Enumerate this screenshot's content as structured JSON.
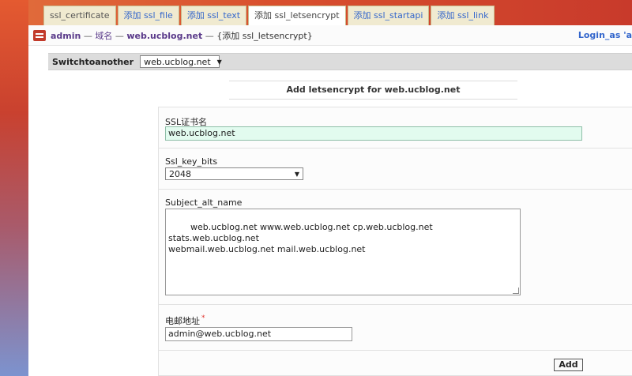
{
  "tabs": [
    {
      "label": "ssl_certificate",
      "active": false
    },
    {
      "label": "添加 ssl_file",
      "active": false
    },
    {
      "label": "添加 ssl_text",
      "active": false
    },
    {
      "label": "添加 ssl_letsencrypt",
      "active": true
    },
    {
      "label": "添加 ssl_startapi",
      "active": false
    },
    {
      "label": "添加 ssl_link",
      "active": false
    }
  ],
  "header": {
    "user": "admin",
    "dash1": "—",
    "section": "域名",
    "dash2": "—",
    "domain": "web.ucblog.net",
    "dash3": "—",
    "action": "{添加 ssl_letsencrypt}",
    "login_as": "Login_as 'a"
  },
  "switch": {
    "label": "Switchtoanother",
    "selected": "web.ucblog.net"
  },
  "form": {
    "title": "Add letsencrypt for web.ucblog.net",
    "ssl_name_label": "SSL证书名",
    "ssl_name_value": "web.ucblog.net",
    "key_bits_label": "Ssl_key_bits",
    "key_bits_value": "2048",
    "alt_name_label": "Subject_alt_name",
    "alt_name_value": "web.ucblog.net www.web.ucblog.net cp.web.ucblog.net stats.web.ucblog.net\nwebmail.web.ucblog.net mail.web.ucblog.net",
    "email_label": "电邮地址",
    "email_required_mark": "*",
    "email_value": "admin@web.ucblog.net",
    "submit_label": "Add"
  },
  "colors": {
    "link": "#3366cc",
    "tab_bg": "#f0ead0",
    "highlight_input": "#e2fbef",
    "required": "#e0302a"
  }
}
